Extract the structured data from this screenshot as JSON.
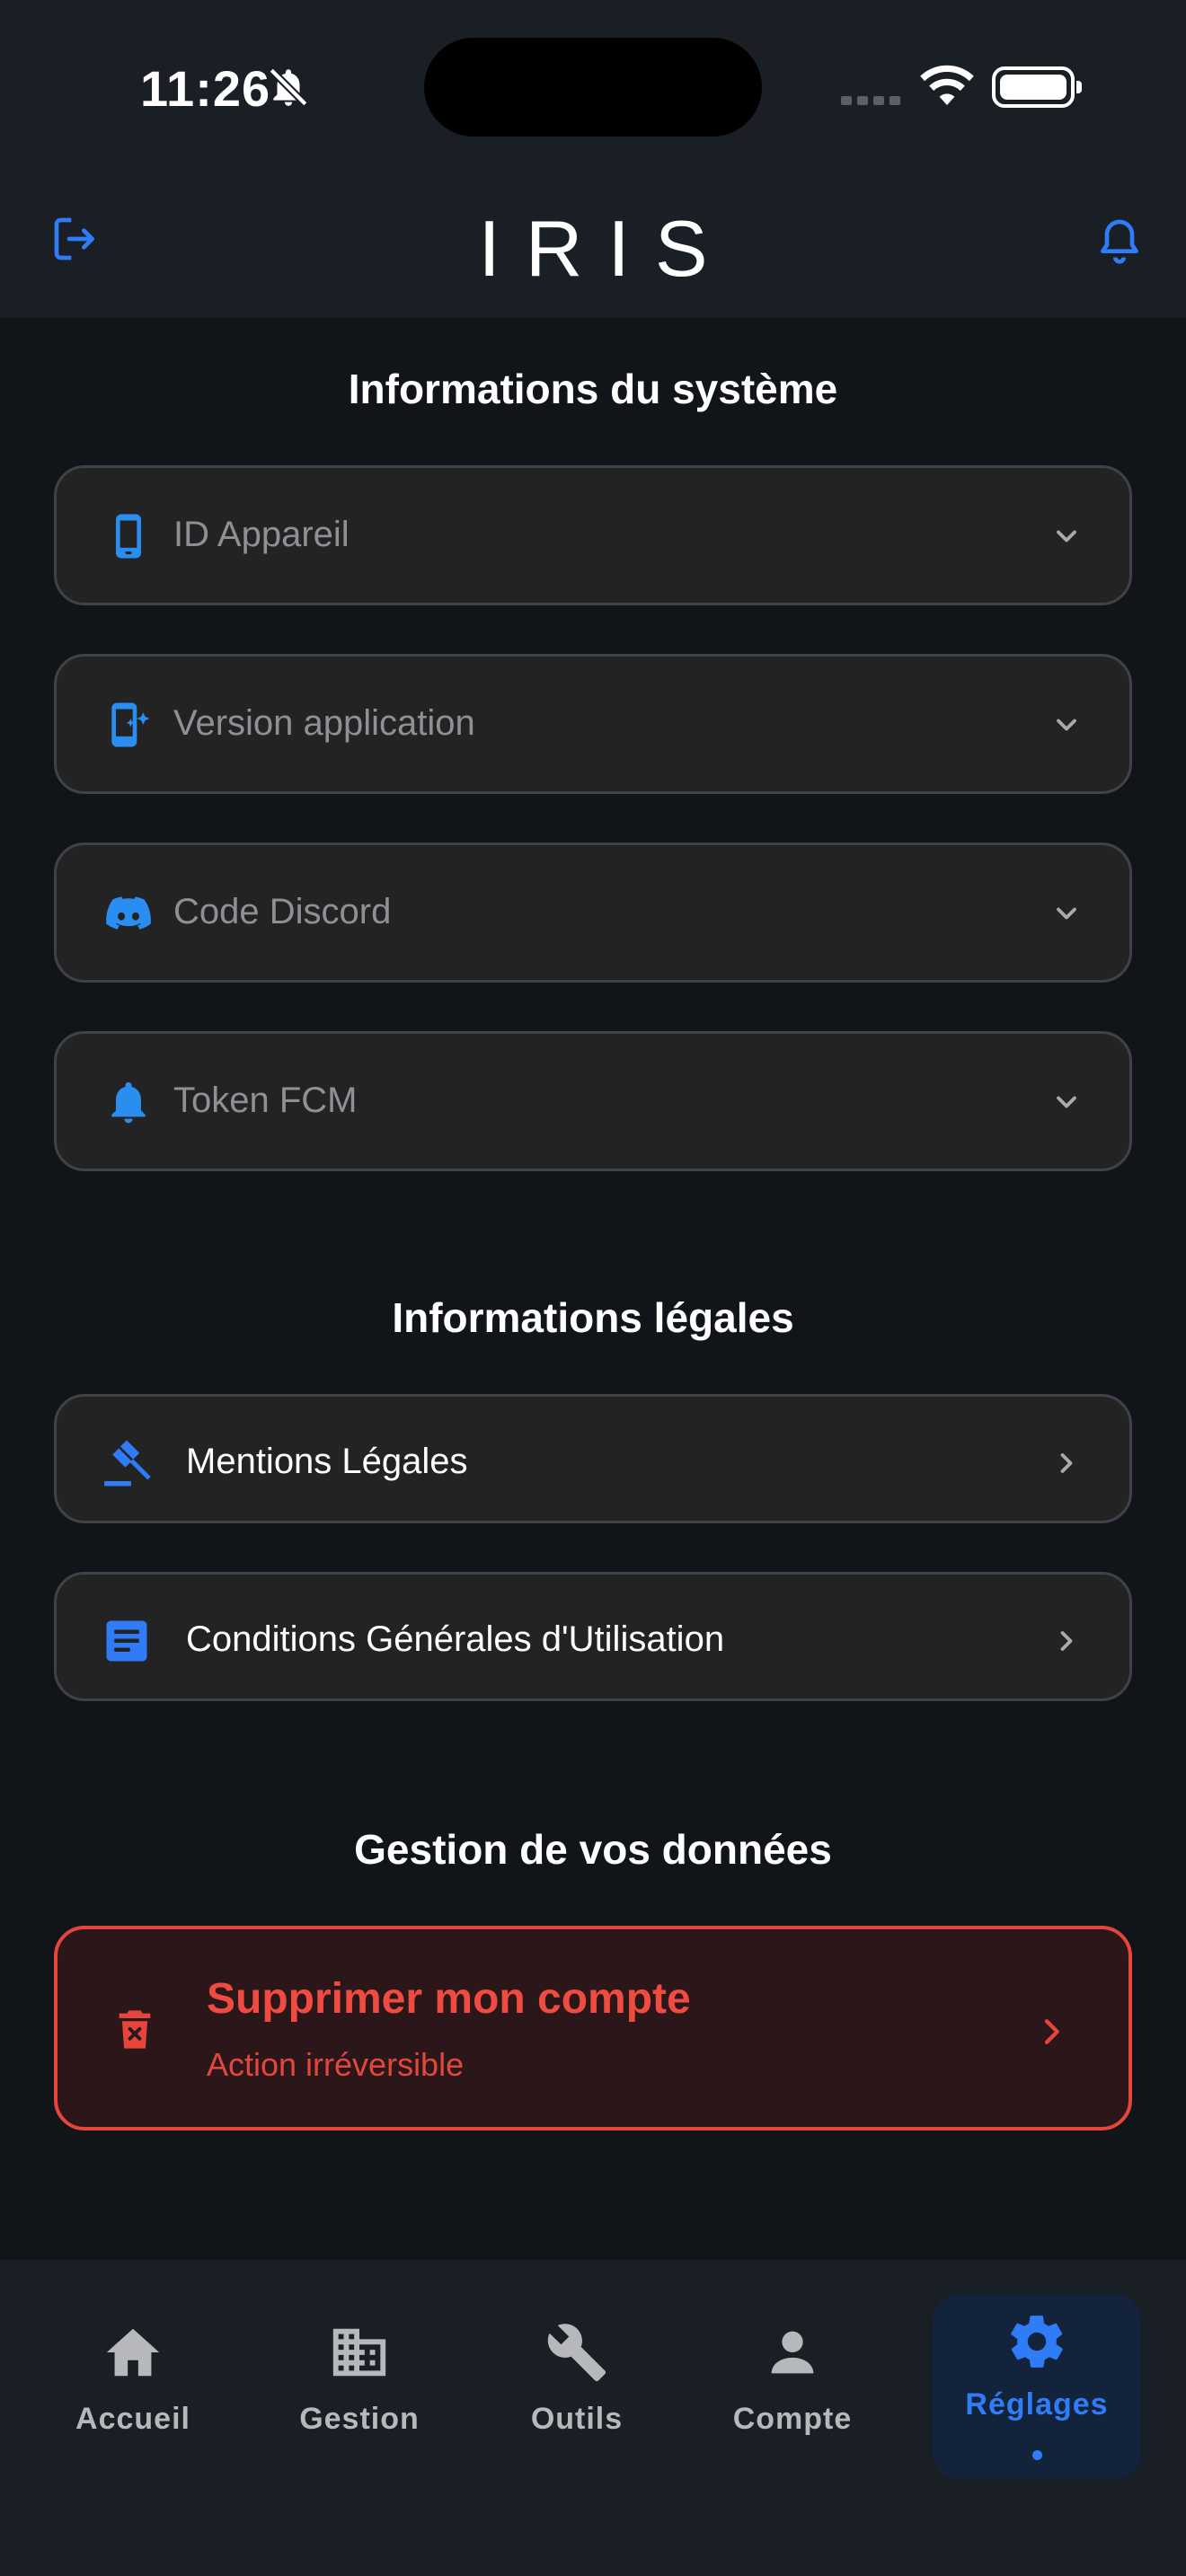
{
  "status_bar": {
    "time": "11:26"
  },
  "header": {
    "title": "IRIS"
  },
  "sections": {
    "system": {
      "title": "Informations du système",
      "items": [
        {
          "label": "ID Appareil",
          "icon": "smartphone-icon"
        },
        {
          "label": "Version application",
          "icon": "app-update-icon"
        },
        {
          "label": "Code Discord",
          "icon": "discord-icon"
        },
        {
          "label": "Token FCM",
          "icon": "bell-icon"
        }
      ]
    },
    "legal": {
      "title": "Informations légales",
      "items": [
        {
          "label": "Mentions Légales",
          "icon": "gavel-icon"
        },
        {
          "label": "Conditions Générales d'Utilisation",
          "icon": "document-icon"
        }
      ]
    },
    "data": {
      "title": "Gestion de vos données",
      "delete_account": {
        "title": "Supprimer mon compte",
        "subtitle": "Action irréversible",
        "icon": "trash-icon"
      }
    }
  },
  "nav": {
    "items": [
      {
        "label": "Accueil",
        "icon": "home-icon"
      },
      {
        "label": "Gestion",
        "icon": "building-icon"
      },
      {
        "label": "Outils",
        "icon": "wrench-icon"
      },
      {
        "label": "Compte",
        "icon": "person-icon"
      },
      {
        "label": "Réglages",
        "icon": "gear-icon",
        "active": true
      }
    ]
  },
  "colors": {
    "accent": "#2f7cf6",
    "icon_blue": "#2a8ef0",
    "danger": "#e5453b",
    "background": "#111418",
    "surface": "#1a1e25",
    "card": "#232323"
  }
}
